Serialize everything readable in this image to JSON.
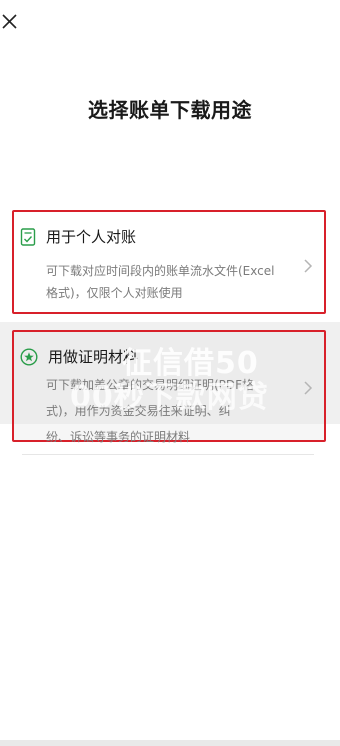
{
  "page": {
    "title": "选择账单下载用途",
    "close_icon": "close-icon"
  },
  "options": [
    {
      "title": "用于个人对账",
      "icon": "document-check-icon",
      "description_line1": "可下载对应时间段内的账单流水文件(Excel",
      "description_line2": "格式)，仅限个人对账使用",
      "chevron": "chevron-right-icon"
    },
    {
      "title": "用做证明材料",
      "icon": "star-badge-icon",
      "description_line1": "可下载加盖公章的交易明细证明(PDF格",
      "description_line2": "式)，用作为资金交易往来证明、纠",
      "description_line3": "纷、诉讼等事务的证明材料",
      "chevron": "chevron-right-icon"
    }
  ],
  "watermark": {
    "line1": "征信借50",
    "line2": "00秒下款网贷"
  },
  "colors": {
    "highlight_border": "#d8202a",
    "icon_green": "#2a9d4a",
    "text_secondary": "#7b7b7b"
  }
}
